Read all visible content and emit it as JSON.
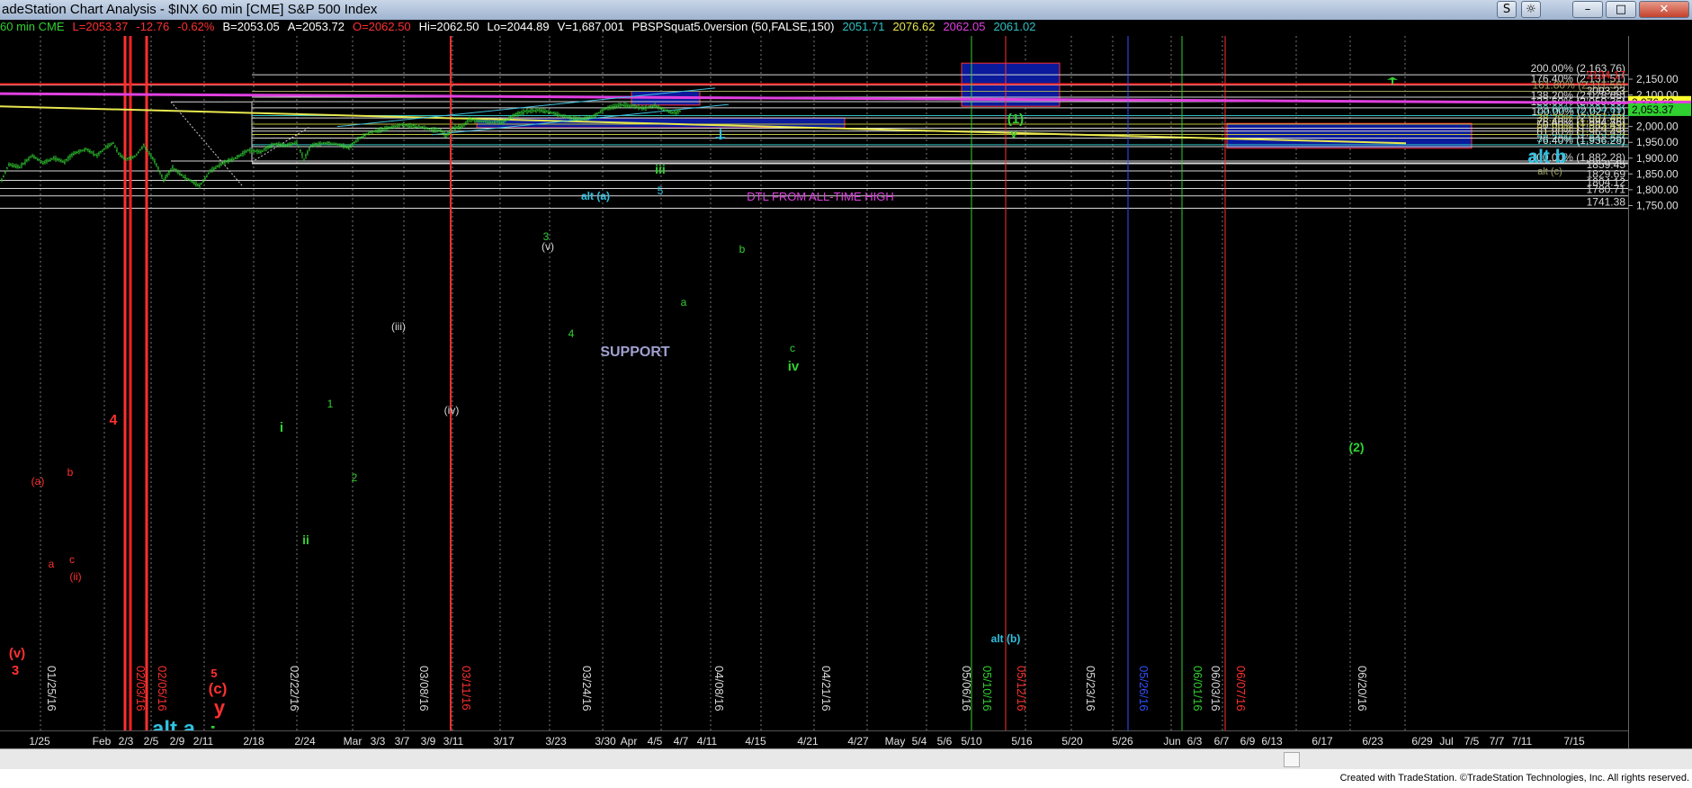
{
  "window": {
    "title": "adeStation Chart Analysis - $INX 60 min [CME] S&P 500 Index",
    "buttons": {
      "s": "S",
      "gear": "☼",
      "minimize": "–",
      "maximize": "□",
      "close": "✕"
    }
  },
  "info": {
    "symbol": "60 min CME",
    "last": "L=2053.37",
    "change": "-12.76",
    "pct": "-0.62%",
    "bid": "B=2053.05",
    "ask": "A=2053.72",
    "open": "O=2062.50",
    "high": "Hi=2062.50",
    "low": "Lo=2044.89",
    "volume": "V=1,687,001",
    "study": "PBSPSquat5.0version (50,FALSE,150)",
    "v1": "2051.71",
    "v2": "2076.62",
    "v3": "2062.05",
    "v4": "2061.02"
  },
  "price_axis": {
    "ticks": [
      "2,150.00",
      "2,100.00",
      "2,050.00",
      "2,000.00",
      "1,950.00",
      "1,900.00",
      "1,850.00",
      "1,800.00",
      "1,750.00"
    ],
    "last_boxes": [
      "2,076.62",
      "2,062.05",
      "2,053.37"
    ]
  },
  "fib_levels": [
    {
      "label": "200.00% (2,163.76)",
      "color": "#d8d8d8"
    },
    {
      "label": "176.40% (2,131.51)",
      "color": "#d8d8d8"
    },
    {
      "label": "2134.17",
      "color": "#ff2020"
    },
    {
      "label": "161.80% (2,111.56)",
      "color": "#a0a060"
    },
    {
      "label": "2093.23",
      "color": "#d8d8d8"
    },
    {
      "label": "138.20% (2,078.68)",
      "color": "#d8d8d8"
    },
    {
      "label": "123.60% (2,059.36)",
      "color": "#d8d8d8"
    },
    {
      "label": "23.60% (2,034.69)",
      "color": "#30c0c0"
    },
    {
      "label": "100.00% (2,027.11)",
      "color": "#d8d8d8"
    },
    {
      "label": "38.20% (2,007.48)",
      "color": "#c0c040"
    },
    {
      "label": "76.40% (1,994.86)",
      "color": "#d8d8d8"
    },
    {
      "label": "50.00% (1,985.49)",
      "color": "#d8d8d8"
    },
    {
      "label": "61.80% (1,974.91)",
      "color": "#c0c040"
    },
    {
      "label": "61.80% (1,963.49)",
      "color": "#d8d8d8"
    },
    {
      "label": "38.20% (1,942.66)",
      "color": "#30c0c0"
    },
    {
      "label": "76.40% (1,936.28)",
      "color": "#d8d8d8"
    },
    {
      "label": "100.00% (1,882.28)",
      "color": "#d8d8d8"
    },
    {
      "label": "1859.45",
      "color": "#d8d8d8"
    },
    {
      "label": "1829.69",
      "color": "#d8d8d8"
    },
    {
      "label": "1804.12",
      "color": "#d8d8d8"
    },
    {
      "label": "1780.71",
      "color": "#d8d8d8"
    },
    {
      "label": "1741.38",
      "color": "#d8d8d8"
    }
  ],
  "date_axis": [
    "1/25",
    "Feb",
    "2/3",
    "2/5",
    "2/9",
    "2/11",
    "2/18",
    "2/24",
    "Mar",
    "3/3",
    "3/7",
    "3/9",
    "3/11",
    "3/17",
    "3/23",
    "3/30",
    "Apr",
    "4/5",
    "4/7",
    "4/11",
    "4/15",
    "4/21",
    "4/27",
    "May",
    "5/4",
    "5/6",
    "5/10",
    "5/16",
    "5/20",
    "5/26",
    "Jun",
    "6/3",
    "6/7",
    "6/9",
    "6/13",
    "6/17",
    "6/23",
    "6/29",
    "Jul",
    "7/5",
    "7/7",
    "7/11",
    "7/15"
  ],
  "vertical_dates": [
    {
      "label": "01/25/16",
      "color": "#d8d8d8"
    },
    {
      "label": "02/03/16",
      "color": "#ff3030"
    },
    {
      "label": "02/05/16",
      "color": "#ff3030"
    },
    {
      "label": "02/22/16",
      "color": "#d8d8d8"
    },
    {
      "label": "03/08/16",
      "color": "#d8d8d8"
    },
    {
      "label": "03/11/16",
      "color": "#ff3030"
    },
    {
      "label": "03/24/16",
      "color": "#d8d8d8"
    },
    {
      "label": "04/08/16",
      "color": "#d8d8d8"
    },
    {
      "label": "04/21/16",
      "color": "#d8d8d8"
    },
    {
      "label": "05/06/16",
      "color": "#d8d8d8"
    },
    {
      "label": "05/10/16",
      "color": "#30d030"
    },
    {
      "label": "05/12/16",
      "color": "#ff3030"
    },
    {
      "label": "05/23/16",
      "color": "#d8d8d8"
    },
    {
      "label": "05/26/16",
      "color": "#3050ff"
    },
    {
      "label": "06/01/16",
      "color": "#30d030"
    },
    {
      "label": "06/03/16",
      "color": "#d8d8d8"
    },
    {
      "label": "06/07/16",
      "color": "#ff3030"
    },
    {
      "label": "06/20/16",
      "color": "#d8d8d8"
    }
  ],
  "annotations": {
    "dtl": "DTL FROM ALL-TIME HIGH",
    "support": "SUPPORT",
    "alt_a_small": "alt (a)",
    "alt_b_big": "alt b",
    "alt_b_small": "alt (b)",
    "alt_a_big": "alt a",
    "iv_big": "iv",
    "wave1": "(1)",
    "v_green": "v",
    "wave2": "(2)",
    "iii_green": "iii",
    "five_cyan": "5",
    "three_green": "3",
    "v_paren": "(v)",
    "b_green": "b",
    "a_green": "a",
    "four_green": "4",
    "c_green": "c",
    "iv_green": "iv",
    "iii_paren": "(iii)",
    "one_green": "1",
    "two_green": "2",
    "iv_paren": "(iv)",
    "i_green": "i",
    "ii_green": "ii",
    "four_red": "4",
    "a_paren_red": "(a)",
    "b_red": "b",
    "a_red": "a",
    "c_red": "c",
    "ii_paren_red": "(ii)",
    "v_paren_red": "(v)",
    "three_red": "3",
    "five_red": "5",
    "c_paren_red": "(c)",
    "y_red": "y"
  },
  "footer": {
    "text": "Created with TradeStation. ©TradeStation Technologies, Inc. All rights reserved."
  },
  "colors": {
    "fib_gray": "#d8d8d8",
    "red_line": "#ff2020",
    "magenta_line": "#e040e0",
    "yellow_line": "#e8e850",
    "cyan_channel": "#40c0e0",
    "box_fill": "#0a1a9a",
    "box_border": "#ff3030",
    "candles": "#30d030"
  }
}
